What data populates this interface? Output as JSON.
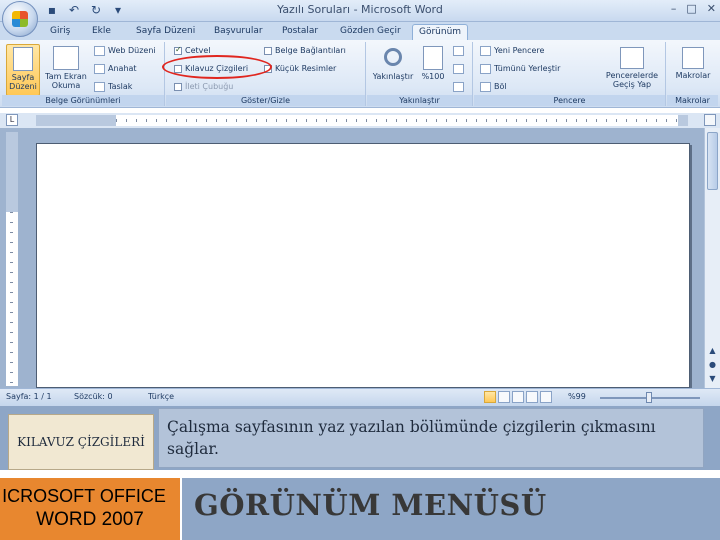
{
  "window": {
    "title": "Yazılı Soruları - Microsoft Word",
    "controls": [
      "–",
      "□",
      "✕"
    ]
  },
  "quick_access": [
    "save",
    "undo",
    "redo",
    "dropdown"
  ],
  "tabs": [
    {
      "label": "Giriş",
      "active": false
    },
    {
      "label": "Ekle",
      "active": false
    },
    {
      "label": "Sayfa Düzeni",
      "active": false
    },
    {
      "label": "Başvurular",
      "active": false
    },
    {
      "label": "Postalar",
      "active": false
    },
    {
      "label": "Gözden Geçir",
      "active": false
    },
    {
      "label": "Görünüm",
      "active": true
    }
  ],
  "ribbon": {
    "belge_gorunumleri": {
      "label": "Belge Görünümleri",
      "sayfa_duzeni": "Sayfa Düzeni",
      "tam_ekran_okuma": "Tam Ekran Okuma",
      "web_duzeni": "Web Düzeni",
      "anahat": "Anahat",
      "taslak": "Taslak"
    },
    "goster_gizle": {
      "label": "Göster/Gizle",
      "cetvel": {
        "label": "Cetvel",
        "checked": true
      },
      "kilavuz_cizgileri": {
        "label": "Kılavuz Çizgileri",
        "checked": false
      },
      "ileti_cubugu": {
        "label": "İleti Çubuğu",
        "checked": false,
        "disabled": true
      },
      "belge_baglantilari": {
        "label": "Belge Bağlantıları",
        "checked": false
      },
      "kucuk_resimler": {
        "label": "Küçük Resimler",
        "checked": false
      }
    },
    "yakinlastir": {
      "label": "Yakınlaştır",
      "yakinlastir_btn": "Yakınlaştır",
      "yuzde_yuz": "%100"
    },
    "pencere": {
      "label": "Pencere",
      "yeni_pencere": "Yeni Pencere",
      "tumunu_yerlestir": "Tümünü Yerleştir",
      "bol": "Böl",
      "pencereler_gecis": "Pencerelerde Geçiş Yap"
    },
    "makrolar": {
      "label": "Makrolar",
      "makrolar_btn": "Makrolar"
    }
  },
  "statusbar": {
    "page": "Sayfa: 1 / 1",
    "words": "Sözcük: 0",
    "language": "Türkçe",
    "zoom": "%99"
  },
  "slide": {
    "term_label": "KILAVUZ ÇİZGİLERİ",
    "description": "Çalışma sayfasının yaz yazılan bölümünde çizgilerin çıkmasını sağlar.",
    "product_line1": "ICROSOFT OFFICE",
    "product_line2": "WORD 2007",
    "heading": "GÖRÜNÜM MENÜSÜ"
  },
  "colors": {
    "annotation_circle": "#e0261f",
    "orange_box": "#e8872f",
    "slide_band": "#8ea6c6"
  }
}
